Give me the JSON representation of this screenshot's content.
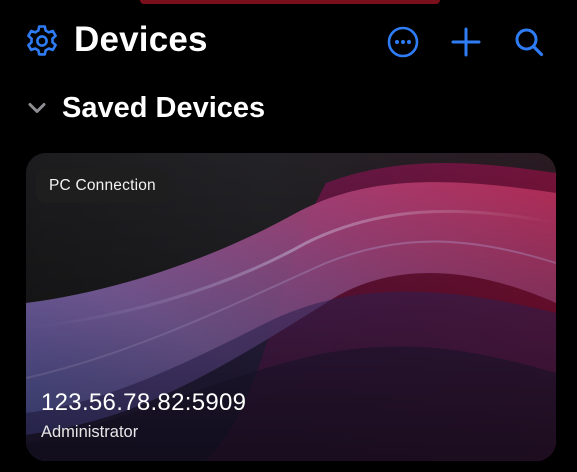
{
  "header": {
    "title": "Devices",
    "settings_icon": "gear-icon",
    "actions": [
      {
        "name": "more",
        "icon": "ellipsis-circle-icon"
      },
      {
        "name": "add",
        "icon": "plus-icon"
      },
      {
        "name": "search",
        "icon": "magnifier-icon"
      }
    ]
  },
  "section": {
    "title": "Saved Devices",
    "icon": "chevron-down-icon",
    "expanded": true
  },
  "devices": [
    {
      "type_label": "PC Connection",
      "address": "123.56.78.82:5909",
      "user": "Administrator"
    }
  ],
  "colors": {
    "background": "#000000",
    "accent": "#2f7df6",
    "text": "#ffffff",
    "card_base": "#1d1d1f"
  }
}
